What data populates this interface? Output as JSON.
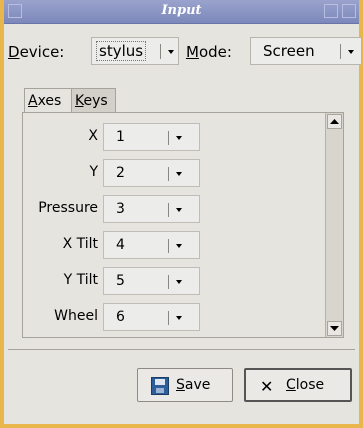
{
  "window": {
    "title": "Input"
  },
  "device": {
    "label_rest": "evice:",
    "label_mnemonic": "D",
    "value": "stylus"
  },
  "mode": {
    "label_rest": "ode:",
    "label_mnemonic": "M",
    "value": "Screen"
  },
  "tabs": [
    {
      "mnemonic": "A",
      "rest": "xes",
      "active": true
    },
    {
      "mnemonic": "K",
      "rest": "eys",
      "active": false
    }
  ],
  "axes": [
    {
      "label": "X",
      "value": "1"
    },
    {
      "label": "Y",
      "value": "2"
    },
    {
      "label": "Pressure",
      "value": "3"
    },
    {
      "label": "X Tilt",
      "value": "4"
    },
    {
      "label": "Y Tilt",
      "value": "5"
    },
    {
      "label": "Wheel",
      "value": "6"
    }
  ],
  "buttons": {
    "save": {
      "mnemonic": "S",
      "rest": "ave"
    },
    "close": {
      "mnemonic": "C",
      "rest": "lose"
    }
  }
}
